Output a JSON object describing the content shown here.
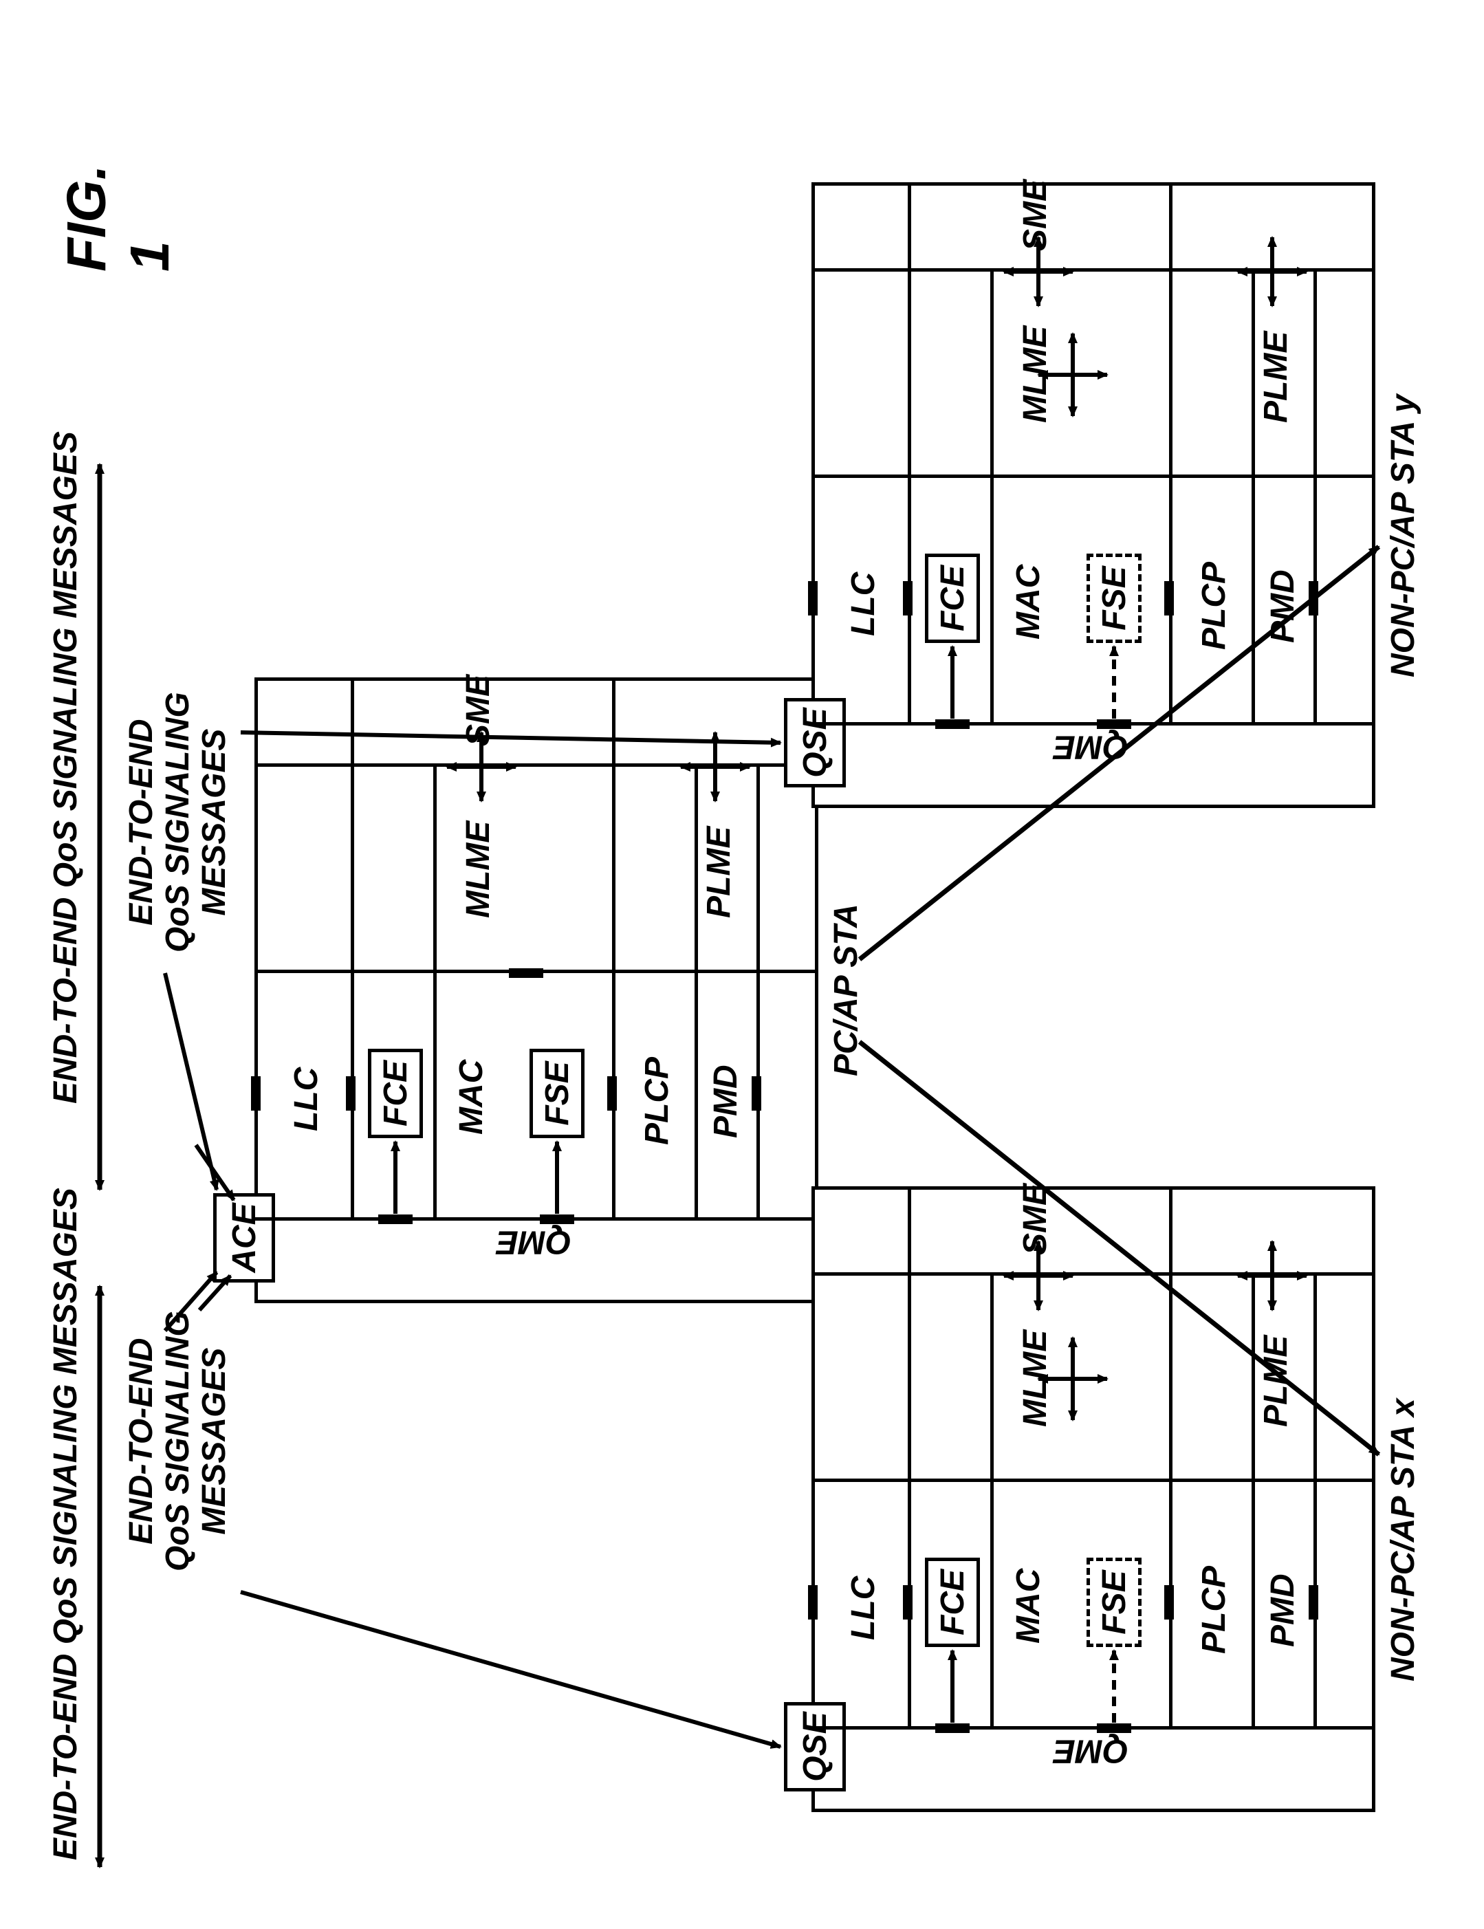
{
  "figure_label": "FIG.  1",
  "top_labels": {
    "left_arrow": "END-TO-END QoS SIGNALING MESSAGES",
    "right_arrow": "END-TO-END QoS SIGNALING MESSAGES",
    "left_drop": "END-TO-END\nQoS SIGNALING\nMESSAGES",
    "right_drop": "END-TO-END\nQoS SIGNALING\nMESSAGES"
  },
  "station_labels": {
    "center": "PC/AP STA",
    "left": "NON-PC/AP STA x",
    "right": "NON-PC/AP STA y"
  },
  "entities": {
    "ace": "ACE",
    "qse": "QSE",
    "fce": "FCE",
    "fse": "FSE",
    "qme": "QME",
    "llc": "LLC",
    "mac": "MAC",
    "plcp": "PLCP",
    "pmd": "PMD",
    "mlme": "MLME",
    "plme": "PLME",
    "sme": "SME"
  }
}
